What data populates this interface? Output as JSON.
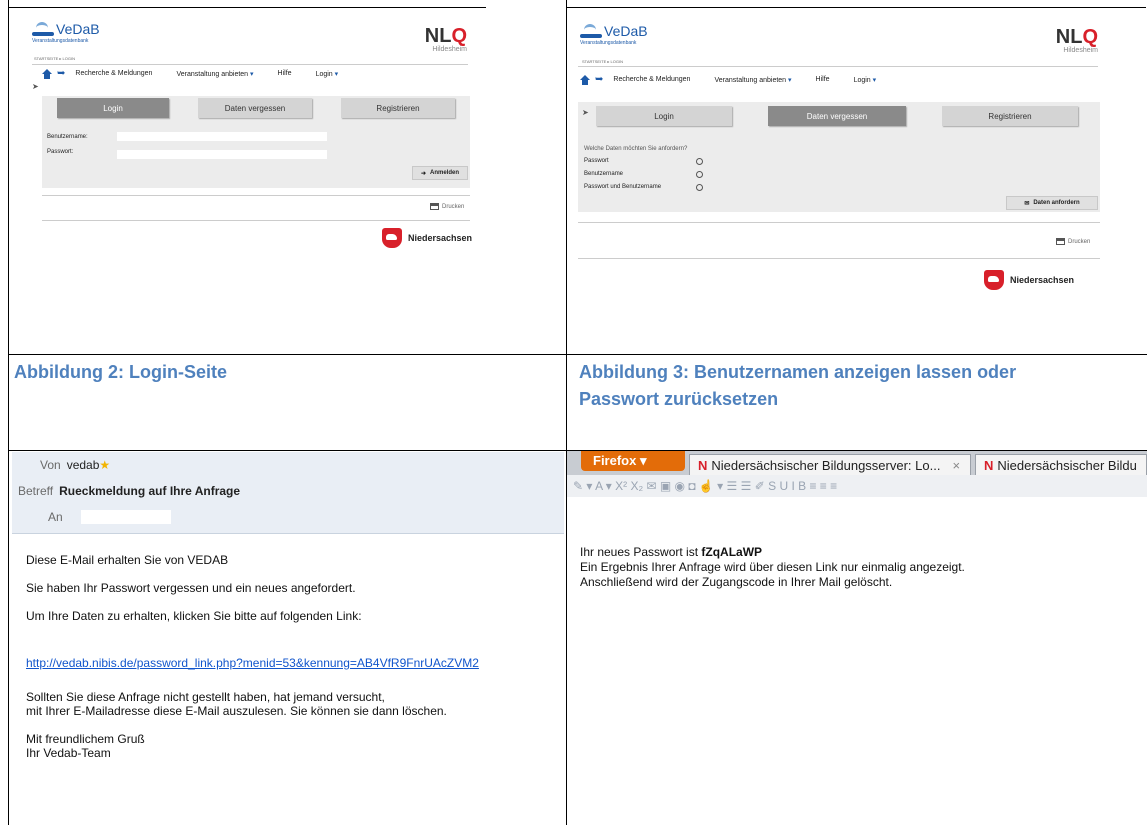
{
  "fig2": {
    "logo_name": "VeDaB",
    "logo_sub": "Veranstaltungsdatenbank",
    "nlq": "NL",
    "nlq_accent": "Q",
    "nlq_sub": "Hildesheim",
    "breadcrumb": "STARTSEITE  ▸ LOGIN",
    "nav": [
      "Recherche & Meldungen",
      "Veranstaltung anbieten",
      "Hilfe",
      "Login"
    ],
    "tabs": [
      "Login",
      "Daten vergessen",
      "Registrieren"
    ],
    "username_label": "Benutzername:",
    "password_label": "Passwort:",
    "login_button": "Anmelden",
    "print": "Drucken",
    "state": "Niedersachsen",
    "caption": "Abbildung 2: Login-Seite"
  },
  "fig3": {
    "logo_name": "VeDaB",
    "logo_sub": "Veranstaltungsdatenbank",
    "nlq": "NL",
    "nlq_accent": "Q",
    "nlq_sub": "Hildesheim",
    "breadcrumb": "STARTSEITE  ▸ LOGIN",
    "nav": [
      "Recherche & Meldungen",
      "Veranstaltung anbieten",
      "Hilfe",
      "Login"
    ],
    "tabs": [
      "Login",
      "Daten vergessen",
      "Registrieren"
    ],
    "question": "Welche Daten möchten Sie anfordern?",
    "options": [
      "Passwort",
      "Benutzername",
      "Passwort und Benutzername"
    ],
    "request_button": "Daten anfordern",
    "print": "Drucken",
    "state": "Niedersachsen",
    "caption_line1": "Abbildung 3: Benutzernamen anzeigen lassen oder",
    "caption_line2": "Passwort zurücksetzen"
  },
  "email": {
    "from_key": "Von",
    "from_val": "vedab",
    "subject_key": "Betreff",
    "subject_val": "Rueckmeldung auf Ihre Anfrage",
    "to_key": "An",
    "line1": "Diese E-Mail erhalten Sie von VEDAB",
    "line2": "Sie haben Ihr Passwort vergessen und ein neues angefordert.",
    "line3": "Um Ihre Daten zu erhalten, klicken Sie bitte auf folgenden Link:",
    "link": "http://vedab.nibis.de/password_link.php?menid=53&kennung=AB4VfR9FnrUAcZVM2",
    "line4": "Sollten Sie diese Anfrage nicht gestellt haben, hat jemand versucht,",
    "line5": "mit Ihrer E-Mailadresse diese E-Mail auszulesen. Sie können sie dann löschen.",
    "line6": "Mit freundlichem Gruß",
    "line7": "Ihr Vedab-Team"
  },
  "browser": {
    "firefox_button": "Firefox ▾",
    "tab1": "Niedersächsischer Bildungsserver: Lo...",
    "tab1_close": "×",
    "tab2": "Niedersächsischer Bildu",
    "tab_icon": "N",
    "toolbar": "✎ ▾  A ▾  X²  X₂  ✉  ▣  ◉  ◘  ☝ ▾  ☰  ☰  ✐  S  U  I  B  ≡  ≡  ≡",
    "text_prefix": "Ihr neues Passwort ist ",
    "password": "fZqALaWP",
    "text2": "Ein Ergebnis Ihrer Anfrage wird über diesen Link nur einmalig angezeigt.",
    "text3": "Anschließend wird der Zugangscode in Ihrer Mail gelöscht."
  }
}
